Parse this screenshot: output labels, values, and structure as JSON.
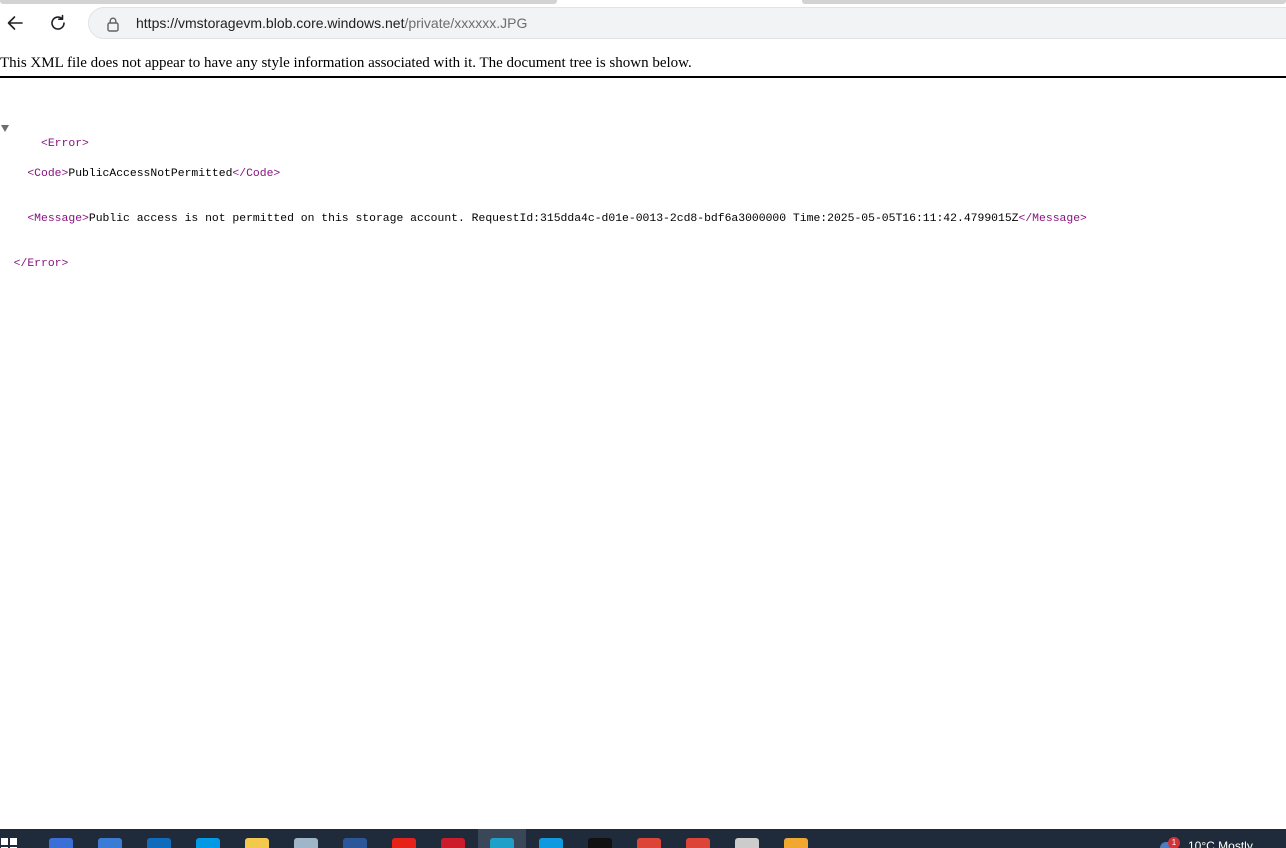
{
  "browser": {
    "url_host": "https://vmstoragevm.blob.core.windows.net",
    "url_path": "/private/xxxxxx.JPG",
    "icons": {
      "back": "arrow-left-icon",
      "reload": "refresh-icon",
      "security": "lock-icon"
    }
  },
  "xml_viewer": {
    "notice": "This XML file does not appear to have any style information associated with it. The document tree is shown below.",
    "root_open": "<Error>",
    "root_close": "</Error>",
    "code_open": "<Code>",
    "code_value": "PublicAccessNotPermitted",
    "code_close": "</Code>",
    "message_open": "<Message>",
    "message_value": "Public access is not permitted on this storage account. RequestId:315dda4c-d01e-0013-2cd8-bdf6a3000000 Time:2025-05-05T16:11:42.4799015Z",
    "message_close": "</Message>"
  },
  "taskbar": {
    "notification_count": "1",
    "tray_text": "10°C  Mostly",
    "apps": [
      {
        "name": "start-icon"
      },
      {
        "name": "copilot-icon",
        "color": "#3b6fd8"
      },
      {
        "name": "calendar-icon",
        "color": "#3a7bd5"
      },
      {
        "name": "outlook-icon",
        "color": "#0f6cbd"
      },
      {
        "name": "skype-icon",
        "color": "#0099e5"
      },
      {
        "name": "file-explorer-icon",
        "color": "#f2c94c"
      },
      {
        "name": "notepad-icon",
        "color": "#9fb6c9"
      },
      {
        "name": "word-icon",
        "color": "#2b579a"
      },
      {
        "name": "youtube-icon",
        "color": "#e62117"
      },
      {
        "name": "opera-icon",
        "color": "#cc1b2b"
      },
      {
        "name": "edge-icon",
        "color": "#1ea0c8"
      },
      {
        "name": "store-icon",
        "color": "#0f9ae0"
      },
      {
        "name": "terminal-icon",
        "color": "#111111"
      },
      {
        "name": "chrome-icon",
        "color": "#db4437"
      },
      {
        "name": "chrome-profile-icon",
        "color": "#db4437"
      },
      {
        "name": "settings-icon",
        "color": "#cccccc"
      },
      {
        "name": "pencil-icon",
        "color": "#f0a830"
      }
    ],
    "colors": {
      "background": "#1f2b3a",
      "xml_tag": "#881280"
    }
  }
}
